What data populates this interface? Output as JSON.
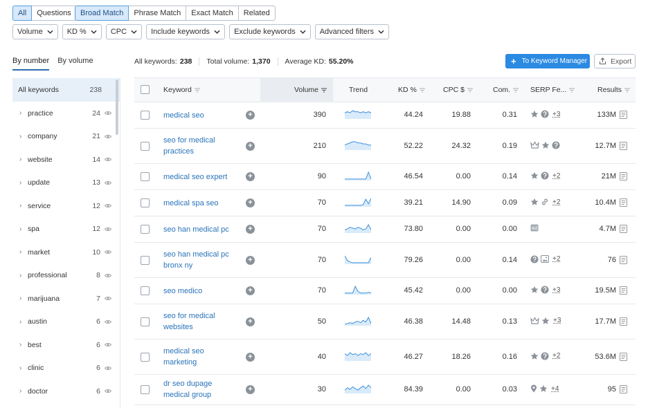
{
  "type_tabs": [
    "All",
    "Questions"
  ],
  "match_tabs": [
    "Broad Match",
    "Phrase Match",
    "Exact Match",
    "Related"
  ],
  "filters": [
    "Volume",
    "KD %",
    "CPC",
    "Include keywords",
    "Exclude keywords",
    "Advanced filters"
  ],
  "left_tabs": [
    "By number",
    "By volume"
  ],
  "sidebar": {
    "all": {
      "label": "All keywords",
      "count": "238"
    },
    "items": [
      {
        "label": "practice",
        "count": "24"
      },
      {
        "label": "company",
        "count": "21"
      },
      {
        "label": "website",
        "count": "14"
      },
      {
        "label": "update",
        "count": "13"
      },
      {
        "label": "service",
        "count": "12"
      },
      {
        "label": "spa",
        "count": "12"
      },
      {
        "label": "market",
        "count": "10"
      },
      {
        "label": "professional",
        "count": "8"
      },
      {
        "label": "marijuana",
        "count": "7"
      },
      {
        "label": "austin",
        "count": "6"
      },
      {
        "label": "best",
        "count": "6"
      },
      {
        "label": "clinic",
        "count": "6"
      },
      {
        "label": "doctor",
        "count": "6"
      }
    ]
  },
  "summary": {
    "all_keywords_label": "All keywords:",
    "all_keywords": "238",
    "total_volume_label": "Total volume:",
    "total_volume": "1,370",
    "avg_kd_label": "Average KD:",
    "avg_kd": "55.20%"
  },
  "buttons": {
    "keyword_manager": "To Keyword Manager",
    "export": "Export"
  },
  "columns": {
    "keyword": "Keyword",
    "volume": "Volume",
    "trend": "Trend",
    "kd": "KD %",
    "cpc": "CPC $",
    "com": "Com.",
    "serp": "SERP Fe...",
    "results": "Results"
  },
  "rows": [
    {
      "kw1": "medical seo",
      "kw2": "",
      "volume": "390",
      "kd": "44.24",
      "cpc": "19.88",
      "com": "0.31",
      "serp": [
        "star",
        "question"
      ],
      "more": "+3",
      "results": "133M"
    },
    {
      "kw1": "seo for medical",
      "kw2": "practices",
      "volume": "210",
      "kd": "52.22",
      "cpc": "24.32",
      "com": "0.19",
      "serp": [
        "crown",
        "star",
        "question"
      ],
      "more": "",
      "results": "12.7M"
    },
    {
      "kw1": "medical seo expert",
      "kw2": "",
      "volume": "90",
      "kd": "46.54",
      "cpc": "0.00",
      "com": "0.14",
      "serp": [
        "star",
        "question"
      ],
      "more": "+2",
      "results": "21M"
    },
    {
      "kw1": "medical spa seo",
      "kw2": "",
      "volume": "70",
      "kd": "39.21",
      "cpc": "14.90",
      "com": "0.09",
      "serp": [
        "star",
        "link"
      ],
      "more": "+2",
      "results": "10.4M"
    },
    {
      "kw1": "seo han medical pc",
      "kw2": "",
      "volume": "70",
      "kd": "73.80",
      "cpc": "0.00",
      "com": "0.00",
      "serp": [
        "ad"
      ],
      "more": "",
      "results": "4.7M"
    },
    {
      "kw1": "seo han medical pc",
      "kw2": "bronx ny",
      "volume": "70",
      "kd": "79.26",
      "cpc": "0.00",
      "com": "0.14",
      "serp": [
        "question",
        "image"
      ],
      "more": "+2",
      "results": "76"
    },
    {
      "kw1": "seo medico",
      "kw2": "",
      "volume": "70",
      "kd": "45.42",
      "cpc": "0.00",
      "com": "0.00",
      "serp": [
        "star",
        "question"
      ],
      "more": "+3",
      "results": "19.5M"
    },
    {
      "kw1": "seo for medical",
      "kw2": "websites",
      "volume": "50",
      "kd": "46.38",
      "cpc": "14.48",
      "com": "0.13",
      "serp": [
        "crown",
        "star"
      ],
      "more": "+3",
      "results": "17.7M"
    },
    {
      "kw1": "medical seo",
      "kw2": "marketing",
      "volume": "40",
      "kd": "46.27",
      "cpc": "18.26",
      "com": "0.16",
      "serp": [
        "star",
        "question"
      ],
      "more": "+2",
      "results": "53.6M"
    },
    {
      "kw1": "dr seo dupage",
      "kw2": "medical group",
      "volume": "30",
      "kd": "84.39",
      "cpc": "0.00",
      "com": "0.03",
      "serp": [
        "pin",
        "star"
      ],
      "more": "+4",
      "results": "95"
    }
  ],
  "trends": [
    [
      5,
      6,
      5,
      7,
      6,
      6,
      5,
      6,
      5,
      6,
      5
    ],
    [
      4,
      5,
      6,
      7,
      7,
      6,
      6,
      5,
      5,
      4,
      4
    ],
    [
      1,
      1,
      1,
      1,
      1,
      1,
      1,
      1,
      1,
      10,
      1
    ],
    [
      1,
      1,
      1,
      1,
      1,
      1,
      1,
      2,
      9,
      3,
      10
    ],
    [
      3,
      4,
      6,
      5,
      4,
      6,
      5,
      3,
      4,
      9,
      3
    ],
    [
      10,
      4,
      2,
      1,
      1,
      1,
      1,
      1,
      1,
      1,
      8
    ],
    [
      1,
      1,
      1,
      1,
      9,
      3,
      1,
      1,
      1,
      2,
      1
    ],
    [
      1,
      2,
      3,
      2,
      4,
      5,
      3,
      6,
      4,
      10,
      2
    ],
    [
      7,
      5,
      8,
      6,
      7,
      5,
      7,
      6,
      8,
      5,
      7
    ],
    [
      3,
      6,
      4,
      7,
      5,
      3,
      6,
      8,
      5,
      9,
      6
    ]
  ]
}
